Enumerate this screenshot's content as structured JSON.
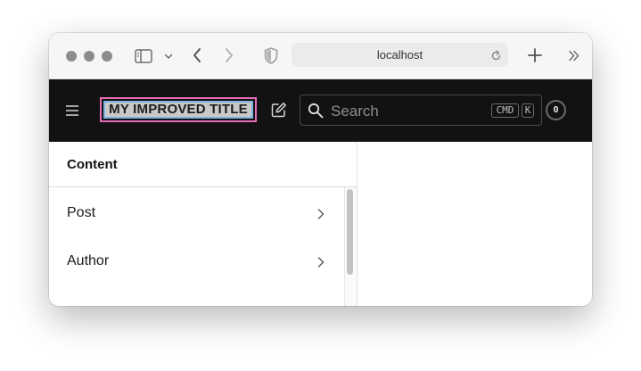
{
  "browser": {
    "url": "localhost"
  },
  "header": {
    "title": "MY IMPROVED TITLE",
    "search_placeholder": "Search",
    "shortcut_mod": "CMD",
    "shortcut_key": "K",
    "notification_count": "0"
  },
  "sidebar": {
    "heading": "Content",
    "items": [
      {
        "label": "Post"
      },
      {
        "label": "Author"
      }
    ]
  },
  "colors": {
    "header_bg": "#121212",
    "title_outline": "#e56fb5",
    "title_inner_outline": "#7eb2e0"
  },
  "icons": {
    "chrome": [
      "sidebar-icon",
      "chevron-down-icon",
      "back-icon",
      "forward-icon",
      "shield-icon",
      "reload-icon",
      "new-tab-icon",
      "more-icon"
    ],
    "app": [
      "menu-icon",
      "edit-icon",
      "search-icon",
      "chevron-right-icon"
    ]
  }
}
